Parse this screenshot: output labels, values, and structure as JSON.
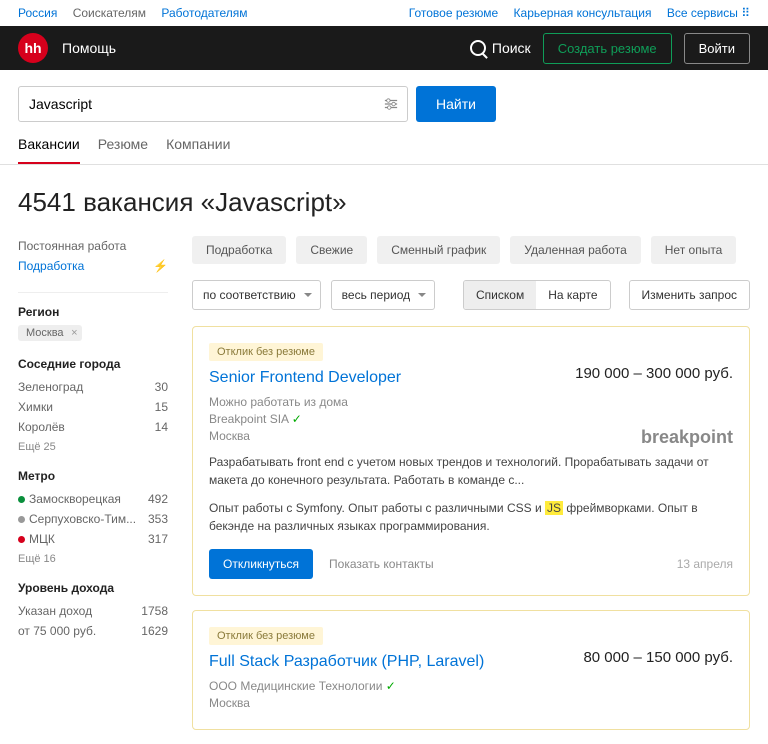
{
  "topbar": {
    "left": [
      {
        "t": "Россия",
        "link": true
      },
      {
        "t": "Соискателям",
        "link": false
      },
      {
        "t": "Работодателям",
        "link": true
      }
    ],
    "right": [
      "Готовое резюме",
      "Карьерная консультация",
      "Все сервисы ⠿"
    ]
  },
  "header": {
    "logo": "hh",
    "help": "Помощь",
    "search": "Поиск",
    "create": "Создать резюме",
    "login": "Войти"
  },
  "search": {
    "value": "Javascript",
    "btn": "Найти"
  },
  "tabs": [
    "Вакансии",
    "Резюме",
    "Компании"
  ],
  "title": "4541 вакансия «Javascript»",
  "side": {
    "work": {
      "perm": "Постоянная работа",
      "part": "Подработка"
    },
    "region": {
      "hdr": "Регион",
      "val": "Москва"
    },
    "neighbor": {
      "hdr": "Соседние города",
      "items": [
        [
          "Зеленоград",
          "30"
        ],
        [
          "Химки",
          "15"
        ],
        [
          "Королёв",
          "14"
        ]
      ],
      "more": "Ещё 25"
    },
    "metro": {
      "hdr": "Метро",
      "items": [
        {
          "c": "#0a8f3c",
          "n": "Замоскворецкая",
          "v": "492"
        },
        {
          "c": "#999",
          "n": "Серпуховско-Тим...",
          "v": "353"
        },
        {
          "c": "#d6001c",
          "n": "МЦК",
          "v": "317"
        }
      ],
      "more": "Ещё 16"
    },
    "income": {
      "hdr": "Уровень дохода",
      "items": [
        [
          "Указан доход",
          "1758"
        ],
        [
          "от 75 000 руб.",
          "1629"
        ]
      ]
    }
  },
  "chips": [
    "Подработка",
    "Свежие",
    "Сменный график",
    "Удаленная работа",
    "Нет опыта"
  ],
  "sort": "по соответствию",
  "period": "весь период",
  "view": {
    "list": "Списком",
    "map": "На карте",
    "edit": "Изменить запрос"
  },
  "jobs": [
    {
      "badge": "Отклик без резюме",
      "title": "Senior Frontend Developer",
      "salary": "190 000 – 300 000 руб.",
      "remote": "Можно работать из дома",
      "company": "Breakpoint SIA",
      "city": "Москва",
      "desc1": "Разрабатывать front end с учетом новых трендов и технологий. Прорабатывать задачи от макета до конечного результата. Работать в команде с...",
      "desc2a": "Опыт работы с Symfony. Опыт работы с различными CSS и ",
      "desc2hl": "JS",
      "desc2b": " фреймворками. Опыт в бекэнде на различных языках программирования.",
      "respond": "Откликнуться",
      "contacts": "Показать контакты",
      "date": "13 апреля",
      "logo": "breakpoint"
    },
    {
      "badge": "Отклик без резюме",
      "title": "Full Stack Разработчик (PHP, Laravel)",
      "salary": "80 000 – 150 000 руб.",
      "company": "ООО Медицинские Технологии",
      "city": "Москва"
    }
  ]
}
